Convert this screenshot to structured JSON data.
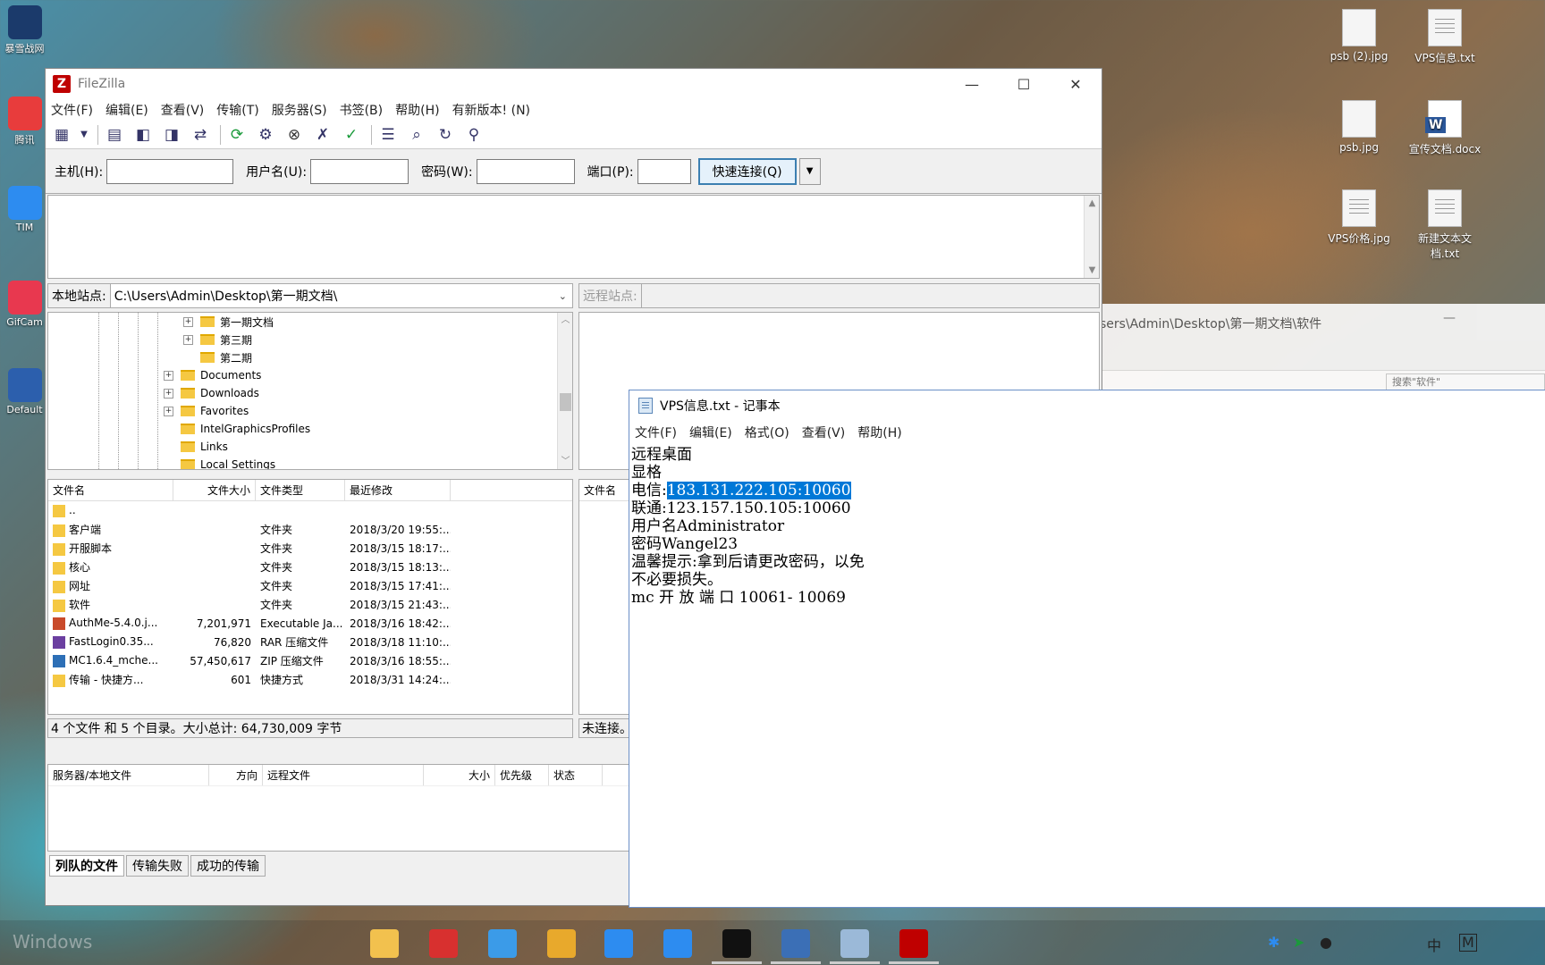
{
  "desktop": {
    "left_apps": [
      {
        "label": "暴雪战网",
        "color": "#1b3a6b"
      },
      {
        "label": "腾讯",
        "color": "#e83c3c"
      },
      {
        "label": "TIM",
        "color": "#2d8cf0"
      },
      {
        "label": "GifCam",
        "color": "#e8384f"
      },
      {
        "label": "Default",
        "color": "#2c5fad"
      }
    ],
    "icons": [
      {
        "label": "psb (2).jpg"
      },
      {
        "label": "VPS信息.txt"
      },
      {
        "label": "psb.jpg"
      },
      {
        "label": "宣传文档.docx"
      },
      {
        "label": "VPS价格.jpg"
      },
      {
        "label": "新建文本文档.txt"
      }
    ],
    "watermark": "Windows"
  },
  "filezilla": {
    "title": "FileZilla",
    "logo": "Z",
    "menu": [
      "文件(F)",
      "编辑(E)",
      "查看(V)",
      "传输(T)",
      "服务器(S)",
      "书签(B)",
      "帮助(H)",
      "有新版本! (N)"
    ],
    "quickconnect": {
      "host_label": "主机(H):",
      "user_label": "用户名(U):",
      "pass_label": "密码(W):",
      "port_label": "端口(P):",
      "button": "快速连接(Q)"
    },
    "local_site_label": "本地站点:",
    "local_path": "C:\\Users\\Admin\\Desktop\\第一期文档\\",
    "remote_site_label": "远程站点:",
    "tree": [
      {
        "label": "第一期文档",
        "expandable": true
      },
      {
        "label": "第三期",
        "expandable": true
      },
      {
        "label": "第二期",
        "expandable": false
      },
      {
        "label": "Documents",
        "expandable": true
      },
      {
        "label": "Downloads",
        "expandable": true
      },
      {
        "label": "Favorites",
        "expandable": true
      },
      {
        "label": "IntelGraphicsProfiles",
        "expandable": false
      },
      {
        "label": "Links",
        "expandable": false
      },
      {
        "label": "Local Settings",
        "expandable": false
      }
    ],
    "local_columns": [
      "文件名",
      "文件大小",
      "文件类型",
      "最近修改"
    ],
    "local_files": [
      {
        "name": "..",
        "size": "",
        "type": "",
        "modified": "",
        "icon": "folder"
      },
      {
        "name": "客户端",
        "size": "",
        "type": "文件夹",
        "modified": "2018/3/20 19:55:...",
        "icon": "folder"
      },
      {
        "name": "开服脚本",
        "size": "",
        "type": "文件夹",
        "modified": "2018/3/15 18:17:...",
        "icon": "folder"
      },
      {
        "name": "核心",
        "size": "",
        "type": "文件夹",
        "modified": "2018/3/15 18:13:...",
        "icon": "folder"
      },
      {
        "name": "网址",
        "size": "",
        "type": "文件夹",
        "modified": "2018/3/15 17:41:...",
        "icon": "folder"
      },
      {
        "name": "软件",
        "size": "",
        "type": "文件夹",
        "modified": "2018/3/15 21:43:...",
        "icon": "folder"
      },
      {
        "name": "AuthMe-5.4.0.j...",
        "size": "7,201,971",
        "type": "Executable Ja...",
        "modified": "2018/3/16 18:42:...",
        "icon": "jar"
      },
      {
        "name": "FastLogin0.35...",
        "size": "76,820",
        "type": "RAR 压缩文件",
        "modified": "2018/3/18 11:10:...",
        "icon": "rar"
      },
      {
        "name": "MC1.6.4_mche...",
        "size": "57,450,617",
        "type": "ZIP 压缩文件",
        "modified": "2018/3/16 18:55:...",
        "icon": "zip"
      },
      {
        "name": "传输 - 快捷方...",
        "size": "601",
        "type": "快捷方式",
        "modified": "2018/3/31 14:24:...",
        "icon": "folder"
      }
    ],
    "remote_columns": [
      "文件名"
    ],
    "local_status": "4 个文件 和 5 个目录。大小总计: 64,730,009 字节",
    "remote_status": "未连接。",
    "queue_columns": [
      "服务器/本地文件",
      "方向",
      "远程文件",
      "大小",
      "优先级",
      "状态"
    ],
    "queue_tabs": [
      "列队的文件",
      "传输失败",
      "成功的传输"
    ]
  },
  "explorer": {
    "path": "sers\\Admin\\Desktop\\第一期文档\\软件",
    "search_placeholder": "搜索\"软件\""
  },
  "notepad": {
    "title": "VPS信息.txt - 记事本",
    "menu": [
      "文件(F)",
      "编辑(E)",
      "格式(O)",
      "查看(V)",
      "帮助(H)"
    ],
    "lines": [
      "远程桌面",
      "显格",
      "电信:",
      "联通:123.157.150.105:10060",
      "用户名Administrator",
      "密码Wangel23",
      "温馨提示:拿到后请更改密码，以免",
      "不必要损失。",
      "mc 开 放 端 口 10061- 10069"
    ],
    "selected_text": "183.131.222.105:10060"
  },
  "taskbar": {
    "apps": [
      {
        "name": "file-explorer",
        "color": "#f2c14e"
      },
      {
        "name": "netease-music",
        "color": "#d8302f"
      },
      {
        "name": "cloud",
        "color": "#3b9be8"
      },
      {
        "name": "chrome",
        "color": "#e8a92c"
      },
      {
        "name": "tim",
        "color": "#2d8cf0"
      },
      {
        "name": "note",
        "color": "#2d8cf0"
      },
      {
        "name": "recorder",
        "color": "#111111"
      },
      {
        "name": "remote-desktop",
        "color": "#3b6fb6"
      },
      {
        "name": "notepad",
        "color": "#9bb9d8"
      },
      {
        "name": "filezilla",
        "color": "#bf0000"
      }
    ],
    "tray_ime": "中",
    "tray_m": "M"
  }
}
